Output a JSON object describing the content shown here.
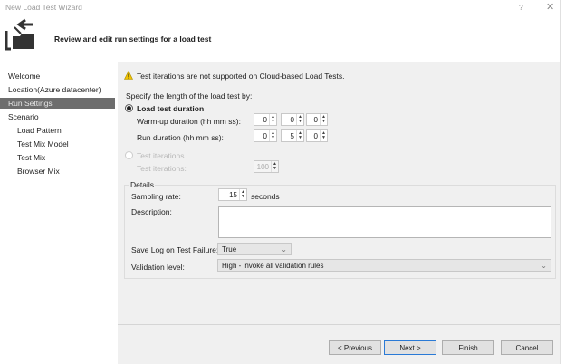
{
  "window": {
    "title": "New Load Test Wizard",
    "help": "?",
    "close": "✕"
  },
  "header": {
    "title": "Review and edit run settings for a load test"
  },
  "nav": {
    "items": [
      "Welcome",
      "Location(Azure datacenter)",
      "Run Settings",
      "Scenario",
      "Load Pattern",
      "Test Mix Model",
      "Test Mix",
      "Browser Mix"
    ],
    "selected": "Run Settings"
  },
  "main": {
    "warning": "Test iterations are not supported on Cloud-based Load Tests.",
    "specify_label": "Specify the length of the load test by:",
    "duration_radio": "Load test duration",
    "warmup_label": "Warm-up duration (hh mm ss):",
    "warmup": [
      "0",
      "0",
      "0"
    ],
    "run_label": "Run duration (hh mm ss):",
    "run": [
      "0",
      "5",
      "0"
    ],
    "iterations_radio": "Test iterations",
    "iterations_label": "Test iterations:",
    "iterations_value": "100",
    "details": {
      "legend": "Details",
      "sampling_label": "Sampling rate:",
      "sampling_value": "15",
      "sampling_unit": "seconds",
      "description_label": "Description:",
      "description_value": "",
      "savelog_label": "Save Log on Test Failure:",
      "savelog_value": "True",
      "validation_label": "Validation level:",
      "validation_value": "High - invoke all validation rules"
    }
  },
  "buttons": {
    "previous": "< Previous",
    "next": "Next >",
    "finish": "Finish",
    "cancel": "Cancel"
  }
}
